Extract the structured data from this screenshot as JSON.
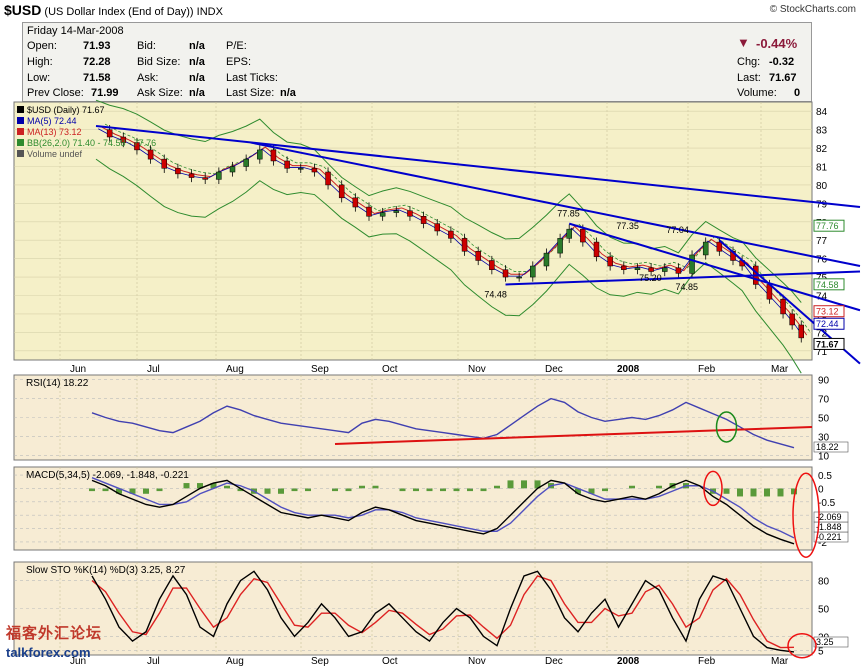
{
  "header": {
    "symbol": "$USD",
    "name": "(US Dollar Index (End of Day))",
    "exchange": "INDX",
    "source": "© StockCharts.com"
  },
  "quote": {
    "date": "Friday  14-Mar-2008",
    "open_label": "Open:",
    "open": "71.93",
    "high_label": "High:",
    "high": "72.28",
    "low_label": "Low:",
    "low": "71.58",
    "prev_label": "Prev Close:",
    "prev": "71.99",
    "bid_label": "Bid:",
    "bid": "n/a",
    "bidsize_label": "Bid Size:",
    "bidsize": "n/a",
    "ask_label": "Ask:",
    "ask": "n/a",
    "asksize_label": "Ask Size:",
    "asksize": "n/a",
    "pe_label": "P/E:",
    "eps_label": "EPS:",
    "lastticks_label": "Last Ticks:",
    "lastsize_label": "Last Size:",
    "lastsize": "n/a",
    "change_pct": "-0.44%",
    "chg_label": "Chg:",
    "chg": "-0.32",
    "last_label": "Last:",
    "last": "71.67",
    "vol_label": "Volume:",
    "vol": "0"
  },
  "colors": {
    "price_bg": "#f5f0c8",
    "ind_bg": "#f7ecd4",
    "trend": "#0000cc",
    "up": "#2a7a2a",
    "down": "#cc0000",
    "ma5": "#0000aa",
    "ma13": "#cc2222",
    "bb": "#2e8b2e"
  },
  "watermark": {
    "cn": "福客外汇论坛",
    "en": "talkforex.com"
  },
  "chart_data": [
    {
      "type": "candlestick",
      "panel": "price",
      "legend": [
        "$USD (Daily) 71.67",
        "MA(5) 72.44",
        "MA(13) 73.12",
        "BB(26,2.0) 71.40 - 74.58 - 77.76",
        "Volume undef"
      ],
      "months": [
        "Jun",
        "Jul",
        "Aug",
        "Sep",
        "Oct",
        "Nov",
        "Dec",
        "2008",
        "Feb",
        "Mar"
      ],
      "y_ticks": [
        71,
        72,
        73,
        74,
        75,
        76,
        77,
        78,
        79,
        80,
        81,
        82,
        83,
        84
      ],
      "ylim": [
        70.5,
        84.5
      ],
      "axis_badges": [
        "77.76",
        "74.58",
        "73.12",
        "72.44",
        "71.67"
      ],
      "annotations": [
        "77.85",
        "77.35",
        "77.04",
        "74.48",
        "75.20",
        "74.85"
      ],
      "close_path": [
        [
          0,
          83.0
        ],
        [
          3,
          82.6
        ],
        [
          6,
          82.3
        ],
        [
          9,
          81.9
        ],
        [
          12,
          81.4
        ],
        [
          15,
          80.9
        ],
        [
          18,
          80.6
        ],
        [
          21,
          80.4
        ],
        [
          24,
          80.3
        ],
        [
          27,
          80.7
        ],
        [
          30,
          81.0
        ],
        [
          33,
          81.4
        ],
        [
          36,
          81.9
        ],
        [
          39,
          81.3
        ],
        [
          42,
          80.9
        ],
        [
          45,
          80.9
        ],
        [
          48,
          80.7
        ],
        [
          51,
          80.0
        ],
        [
          54,
          79.3
        ],
        [
          57,
          78.8
        ],
        [
          60,
          78.3
        ],
        [
          63,
          78.5
        ],
        [
          66,
          78.6
        ],
        [
          69,
          78.3
        ],
        [
          72,
          77.9
        ],
        [
          75,
          77.5
        ],
        [
          78,
          77.1
        ],
        [
          81,
          76.4
        ],
        [
          84,
          75.9
        ],
        [
          87,
          75.4
        ],
        [
          90,
          75.0
        ],
        [
          93,
          75.0
        ],
        [
          96,
          75.6
        ],
        [
          99,
          76.3
        ],
        [
          102,
          77.1
        ],
        [
          104,
          77.6
        ],
        [
          107,
          76.9
        ],
        [
          110,
          76.1
        ],
        [
          113,
          75.6
        ],
        [
          116,
          75.4
        ],
        [
          119,
          75.5
        ],
        [
          122,
          75.3
        ],
        [
          125,
          75.5
        ],
        [
          128,
          75.2
        ],
        [
          131,
          76.2
        ],
        [
          134,
          76.9
        ],
        [
          137,
          76.4
        ],
        [
          140,
          75.9
        ],
        [
          142,
          75.6
        ],
        [
          145,
          74.6
        ],
        [
          148,
          73.8
        ],
        [
          151,
          73.0
        ],
        [
          153,
          72.4
        ],
        [
          155,
          71.7
        ]
      ],
      "trendlines": [
        {
          "from": [
            0,
            83.2
          ],
          "to": [
            190,
            78.8
          ]
        },
        {
          "from": [
            34,
            82.3
          ],
          "to": [
            190,
            75.6
          ]
        },
        {
          "from": [
            90,
            74.6
          ],
          "to": [
            190,
            75.3
          ]
        },
        {
          "from": [
            104,
            77.9
          ],
          "to": [
            190,
            73.2
          ]
        },
        {
          "from": [
            137,
            77.0
          ],
          "to": [
            190,
            70.3
          ]
        }
      ]
    },
    {
      "type": "line",
      "panel": "rsi",
      "title": "RSI(14) 18.22",
      "y_ticks": [
        10,
        30,
        50,
        70,
        90
      ],
      "ylim": [
        5,
        95
      ],
      "value_badge": "18.22",
      "values": [
        55,
        50,
        46,
        44,
        40,
        36,
        34,
        40,
        46,
        55,
        62,
        58,
        52,
        48,
        44,
        42,
        40,
        38,
        36,
        34,
        44,
        48,
        46,
        42,
        38,
        36,
        34,
        32,
        30,
        28,
        32,
        42,
        52,
        62,
        70,
        66,
        56,
        50,
        46,
        48,
        50,
        48,
        52,
        58,
        66,
        60,
        54,
        48,
        40,
        32,
        26,
        22,
        18
      ]
    },
    {
      "type": "line",
      "panel": "macd",
      "title": "MACD(5,34,5) -2.069, -1.848, -0.221",
      "y_ticks": [
        0.5,
        0.0,
        -0.5,
        -1.0,
        -1.5,
        -2.0
      ],
      "ylim": [
        -2.3,
        0.8
      ],
      "value_badges": [
        "-0.221",
        "-1.848",
        "-2.069"
      ],
      "macd": [
        0.3,
        0.1,
        -0.2,
        -0.4,
        -0.6,
        -0.7,
        -0.6,
        -0.3,
        0.0,
        0.2,
        0.3,
        0.0,
        -0.3,
        -0.6,
        -0.9,
        -1.0,
        -1.1,
        -1.0,
        -1.1,
        -1.2,
        -0.9,
        -0.7,
        -0.8,
        -1.0,
        -1.2,
        -1.3,
        -1.4,
        -1.5,
        -1.6,
        -1.7,
        -1.5,
        -1.0,
        -0.5,
        0.0,
        0.3,
        0.2,
        -0.2,
        -0.4,
        -0.5,
        -0.4,
        -0.3,
        -0.4,
        -0.2,
        0.1,
        0.3,
        0.1,
        -0.3,
        -0.6,
        -1.0,
        -1.4,
        -1.7,
        -1.9,
        -2.069
      ],
      "signal": [
        0.4,
        0.2,
        0.0,
        -0.2,
        -0.4,
        -0.6,
        -0.6,
        -0.5,
        -0.2,
        0.0,
        0.2,
        0.1,
        -0.1,
        -0.4,
        -0.7,
        -0.9,
        -1.0,
        -1.0,
        -1.0,
        -1.1,
        -1.0,
        -0.8,
        -0.8,
        -0.9,
        -1.1,
        -1.2,
        -1.3,
        -1.4,
        -1.5,
        -1.6,
        -1.6,
        -1.3,
        -0.8,
        -0.3,
        0.1,
        0.2,
        0.0,
        -0.2,
        -0.4,
        -0.4,
        -0.4,
        -0.4,
        -0.3,
        -0.1,
        0.1,
        0.1,
        -0.1,
        -0.4,
        -0.7,
        -1.1,
        -1.4,
        -1.6,
        -1.848
      ]
    },
    {
      "type": "line",
      "panel": "stochastic",
      "title": "Slow STO %K(14) %D(3) 3.25, 8.27",
      "y_ticks": [
        80,
        50,
        20,
        5
      ],
      "ylim": [
        0,
        100
      ],
      "value_badge": "3.25",
      "k": [
        85,
        60,
        30,
        15,
        25,
        60,
        85,
        65,
        30,
        20,
        55,
        80,
        90,
        70,
        40,
        20,
        35,
        55,
        40,
        20,
        25,
        45,
        55,
        40,
        25,
        15,
        35,
        50,
        40,
        20,
        10,
        50,
        85,
        90,
        70,
        40,
        25,
        45,
        60,
        30,
        55,
        80,
        70,
        40,
        15,
        60,
        85,
        80,
        50,
        20,
        8,
        5,
        3.25
      ],
      "d": [
        80,
        68,
        45,
        25,
        22,
        45,
        72,
        72,
        50,
        30,
        40,
        65,
        82,
        78,
        55,
        32,
        30,
        45,
        45,
        32,
        24,
        35,
        48,
        45,
        33,
        22,
        28,
        42,
        43,
        30,
        18,
        32,
        65,
        85,
        80,
        55,
        35,
        35,
        50,
        42,
        45,
        68,
        75,
        55,
        30,
        40,
        70,
        82,
        65,
        38,
        15,
        8,
        8.27
      ]
    }
  ]
}
